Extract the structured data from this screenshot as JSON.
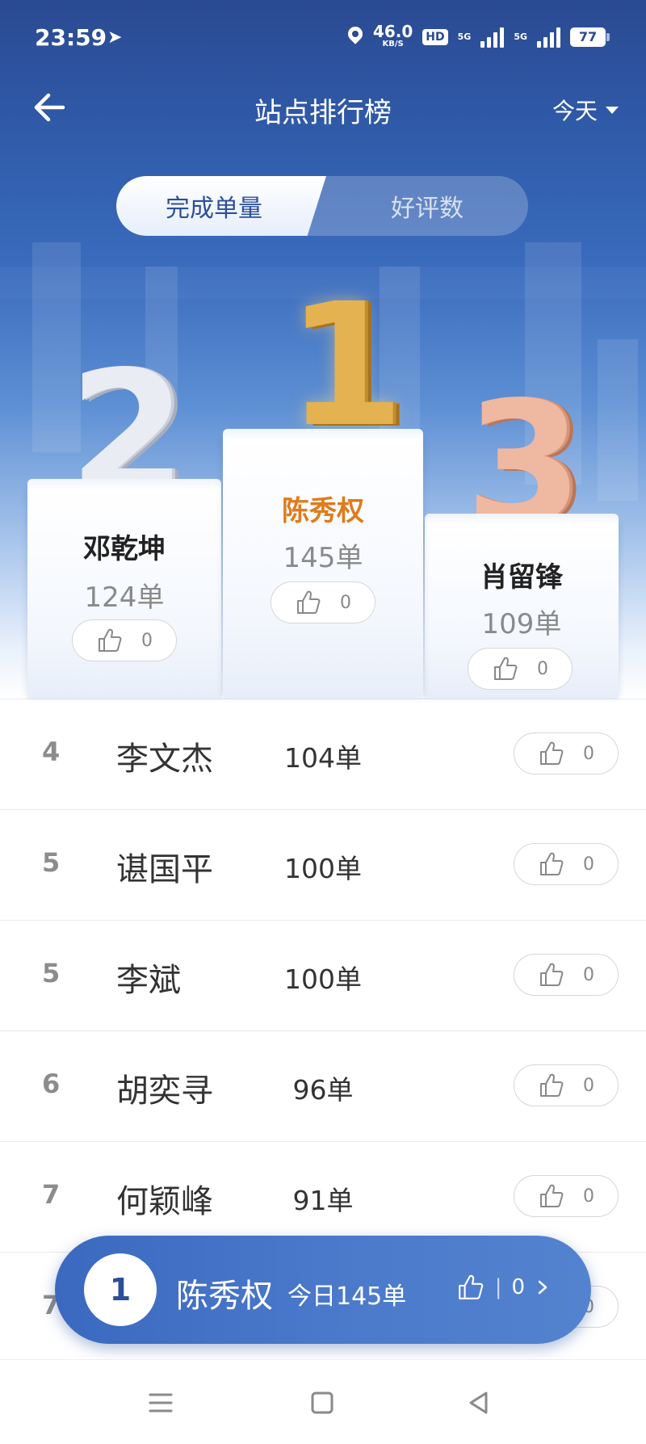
{
  "status_bar": {
    "time": "23:59",
    "speed_value": "46.0",
    "speed_unit": "KB/S",
    "hd": "HD",
    "net1": "5G",
    "net2": "5G",
    "battery": "77"
  },
  "header": {
    "title": "站点排行榜",
    "period": "今天"
  },
  "tabs": [
    {
      "label": "完成单量",
      "active": true
    },
    {
      "label": "好评数",
      "active": false
    }
  ],
  "podium": {
    "first": {
      "rank": "1",
      "name": "陈秀权",
      "count": "145单",
      "likes": "0"
    },
    "second": {
      "rank": "2",
      "name": "邓乾坤",
      "count": "124单",
      "likes": "0"
    },
    "third": {
      "rank": "3",
      "name": "肖留锋",
      "count": "109单",
      "likes": "0"
    }
  },
  "list": [
    {
      "rank": "4",
      "name": "李文杰",
      "count": "104单",
      "likes": "0"
    },
    {
      "rank": "5",
      "name": "谌国平",
      "count": "100单",
      "likes": "0"
    },
    {
      "rank": "5",
      "name": "李斌",
      "count": "100单",
      "likes": "0"
    },
    {
      "rank": "6",
      "name": "胡奕寻",
      "count": "96单",
      "likes": "0"
    },
    {
      "rank": "7",
      "name": "何颖峰",
      "count": "91单",
      "likes": "0"
    },
    {
      "rank": "7",
      "name": "",
      "count": "",
      "likes": "0"
    }
  ],
  "self": {
    "rank": "1",
    "name": "陈秀权",
    "count_text": "今日145单",
    "likes": "0",
    "separator": "|"
  },
  "icons": {
    "back": "arrow-left-icon",
    "like": "thumbs-up-icon",
    "chevron": "chevron-right-icon",
    "nav_menu": "menu-icon",
    "nav_home": "home-square-icon",
    "nav_back": "back-triangle-icon"
  },
  "colors": {
    "header_blue": "#2a4a92",
    "accent_orange": "#e07b1c",
    "gold": "#e4b250",
    "silver": "#e9ecf3",
    "bronze": "#efb8a0"
  }
}
